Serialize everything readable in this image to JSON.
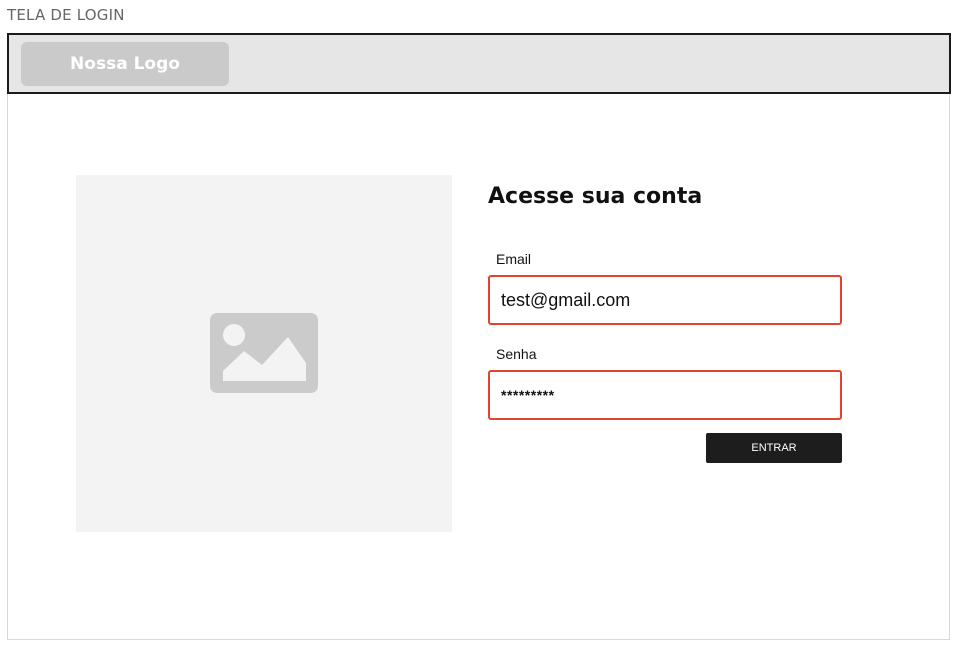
{
  "screen_label": "TELA DE LOGIN",
  "header": {
    "logo_text": "Nossa Logo"
  },
  "main": {
    "image_placeholder_icon": "image-icon",
    "login": {
      "title": "Acesse sua conta",
      "email_label": "Email",
      "email_value": "test@gmail.com",
      "senha_label": "Senha",
      "senha_value": "*********",
      "submit_label": "ENTRAR"
    }
  },
  "colors": {
    "input_border": "#e0452b",
    "button_bg": "#1d1d1d",
    "header_bg": "#e6e6e6",
    "placeholder_bg": "#f3f3f3"
  }
}
